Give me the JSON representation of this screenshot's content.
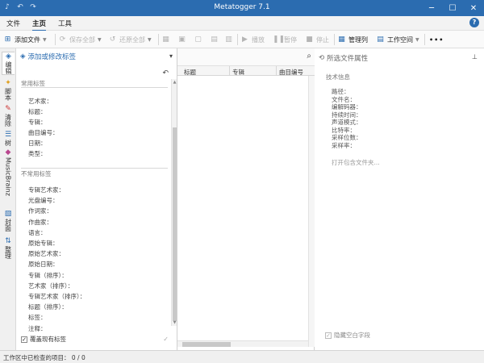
{
  "window": {
    "title": "Metatogger 7.1",
    "minimize_glyph": "─",
    "maximize_glyph": "☐",
    "close_glyph": "✕"
  },
  "menu": {
    "tabs": [
      "文件",
      "主页",
      "工具"
    ],
    "active": 1,
    "help_glyph": "?"
  },
  "toolbar": {
    "add_file": "添加文件",
    "save_all": "保存全部",
    "restore_all": "还原全部",
    "play": "播放",
    "pause": "暂停",
    "stop": "停止",
    "manage_columns": "管理列",
    "workspace": "工作空间",
    "more": "•••"
  },
  "vtabs": [
    "编辑",
    "脚本",
    "清除",
    "树",
    "MusicBrainz",
    "封面",
    "整理"
  ],
  "tag_panel": {
    "title": "添加或修改标签",
    "common_section": "常用标签",
    "common_fields": [
      "艺术家：",
      "标题：",
      "专辑：",
      "曲目编号：",
      "日期：",
      "类型："
    ],
    "uncommon_section": "不常用标签",
    "uncommon_fields": [
      "专辑艺术家：",
      "光盘编号：",
      "作词家：",
      "作曲家：",
      "语言：",
      "原始专辑：",
      "原始艺术家：",
      "原始日期：",
      "专辑（排序）：",
      "艺术家（排序）：",
      "专辑艺术家（排序）：",
      "标题（排序）：",
      "标签：",
      "注释："
    ],
    "overwrite_label": "覆盖现有标签"
  },
  "file_list": {
    "columns": [
      "标题",
      "专辑",
      "曲目编号"
    ]
  },
  "properties": {
    "title": "所选文件属性",
    "section": "技术信息",
    "fields": [
      "路径：",
      "文件名：",
      "编解码器：",
      "持续时间：",
      "声道模式：",
      "比特率：",
      "采样位数：",
      "采样率："
    ],
    "open_folder": "打开包含文件夹...",
    "hide_empty": "隐藏空白字段"
  },
  "status": {
    "text": "工作区中已检查的项目： 0 / 0"
  },
  "colors": {
    "accent": "#2b6cb0"
  }
}
